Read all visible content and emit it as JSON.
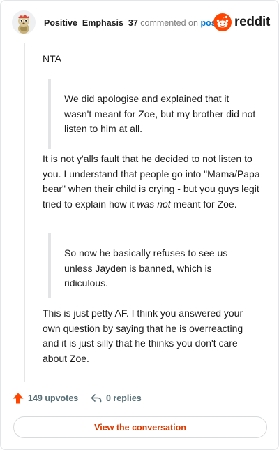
{
  "header": {
    "username": "Positive_Emphasis_37",
    "action_text": "commented on",
    "post_link": "post",
    "brand": "reddit"
  },
  "comment": {
    "p1": "NTA",
    "quote1": "We did apologise and explained that it wasn't meant for Zoe, but my brother did not listen to him at all.",
    "p2_before": "It is not y'alls fault that he decided to not listen to you. I understand that people go into \"Mama/Papa bear\" when their child is crying - but you guys legit tried to explain how it ",
    "p2_em": "was not",
    "p2_after": " meant for Zoe.",
    "quote2": "So now he basically refuses to see us unless Jayden is banned, which is ridiculous.",
    "p3": "This is just petty AF. I think you answered your own question by saying that he is overreacting and it is just silly that he thinks you don't care about Zoe."
  },
  "footer": {
    "upvotes": "149 upvotes",
    "replies": "0 replies",
    "cta": "View the conversation"
  },
  "colors": {
    "reddit_orange": "#ff4500",
    "link_blue": "#0079d3",
    "cta_orange": "#d93a00"
  }
}
